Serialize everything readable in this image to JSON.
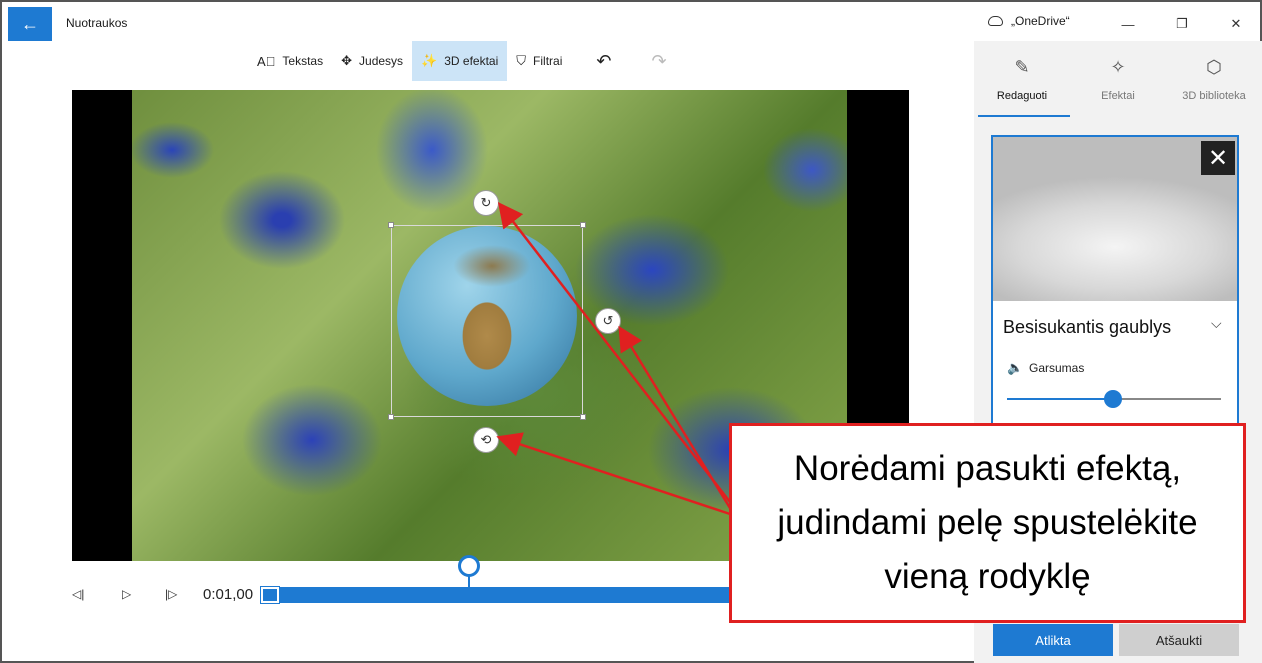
{
  "window": {
    "title": "Nuotraukos",
    "cloud_label": "„OneDrive“",
    "back_glyph": "←",
    "min_glyph": "—",
    "max_glyph": "❐",
    "close_glyph": "✕"
  },
  "toolbar": {
    "items": [
      {
        "label": "Tekstas",
        "icon": "A⃞"
      },
      {
        "label": "Judesys",
        "icon": "✥"
      },
      {
        "label": "3D efektai",
        "icon": "✨"
      },
      {
        "label": "Filtrai",
        "icon": "⛉"
      }
    ],
    "undo_glyph": "↶",
    "redo_glyph": "↷"
  },
  "timeline": {
    "prev_frame": "◁|",
    "play": "▷",
    "next_frame": "|▷",
    "time": "0:01,00"
  },
  "panel": {
    "tabs": [
      {
        "label": "Redaguoti",
        "icon": "✎"
      },
      {
        "label": "Efektai",
        "icon": "✧"
      },
      {
        "label": "3D biblioteka",
        "icon": "⬡"
      }
    ],
    "effect_name": "Besisukantis gaublys",
    "chevron": "⌵",
    "volume_label": "Garsumas",
    "volume_icon": "🔈",
    "volume_level": 0.5,
    "close_glyph": "✕",
    "done_label": "Atlikta",
    "cancel_label": "Atšaukti"
  },
  "handles": {
    "top": "↻",
    "right": "↺",
    "bottom": "⟲"
  },
  "callout": {
    "text": "Norėdami pasukti efektą, judindami pelę spustelėkite vieną rodyklę"
  },
  "colors": {
    "accent": "#1e7ad2",
    "callout_border": "#e02020"
  }
}
